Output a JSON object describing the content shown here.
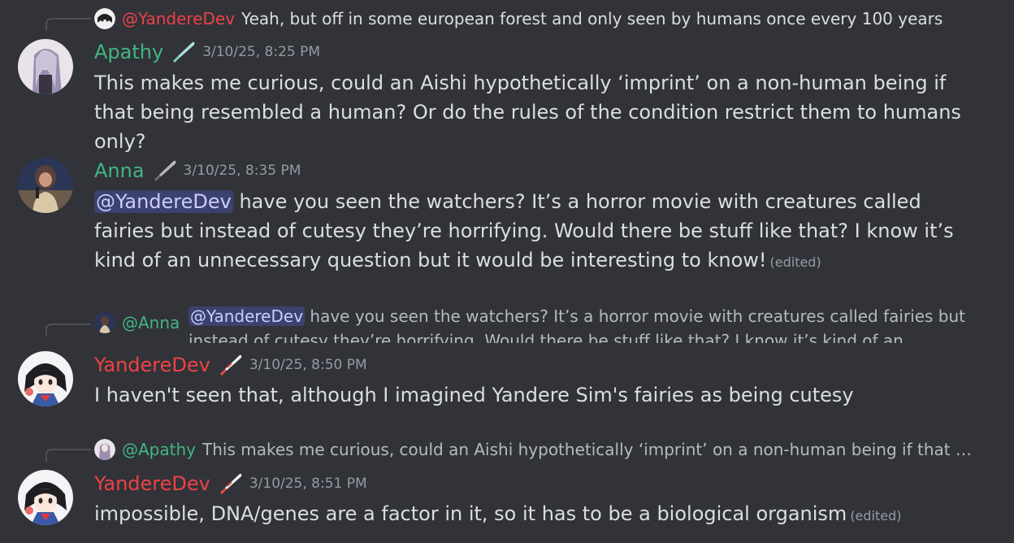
{
  "colors": {
    "background": "#313338",
    "apathy": "#43b581",
    "anna": "#43b581",
    "yandere": "#ed4245",
    "mention_bg": "#3c4270",
    "text": "#dbdee1",
    "muted": "#949ba4"
  },
  "messages": [
    {
      "reply_to": {
        "mention": "@YandereDev",
        "text": "Yeah, but off in some european forest and only seen by humans once every 100 years"
      },
      "author": "Apathy",
      "badge_icon": "knife-icon",
      "timestamp": "3/10/25, 8:25 PM",
      "content": "This makes me curious, could an Aishi hypothetically ‘imprint’ on a non-human being if that being resembled a human? Or do the rules of the condition restrict them to humans only?"
    },
    {
      "author": "Anna",
      "badge_icon": "knife-icon",
      "timestamp": "3/10/25, 8:35 PM",
      "mention": "@YandereDev",
      "content": " have you seen the watchers? It’s a horror movie with creatures called fairies but instead of cutesy they’re horrifying. Would there be stuff like that? I know it’s kind of an unnecessary question but it would be interesting to know!",
      "edited": "(edited)"
    },
    {
      "reply_to": {
        "mention": "@Anna",
        "inner_mention": "@YandereDev",
        "text": " have you seen the watchers? It’s a horror movie with creatures called fairies but instead of cutesy they’re horrifying. Would there be stuff like that? I know it’s kind of an unnecessary question"
      },
      "author": "YandereDev",
      "badge_icon": "knife-icon",
      "timestamp": "3/10/25, 8:50 PM",
      "content": "I haven't seen that, although I imagined Yandere Sim's fairies as being cutesy"
    },
    {
      "reply_to": {
        "mention": "@Apathy",
        "text": "This makes me curious, could an Aishi hypothetically ‘imprint’ on a non-human being if that b..."
      },
      "author": "YandereDev",
      "badge_icon": "knife-icon",
      "timestamp": "3/10/25, 8:51 PM",
      "content": "impossible, DNA/genes are a factor in it, so it has to be a biological organism",
      "edited": "(edited)"
    }
  ]
}
